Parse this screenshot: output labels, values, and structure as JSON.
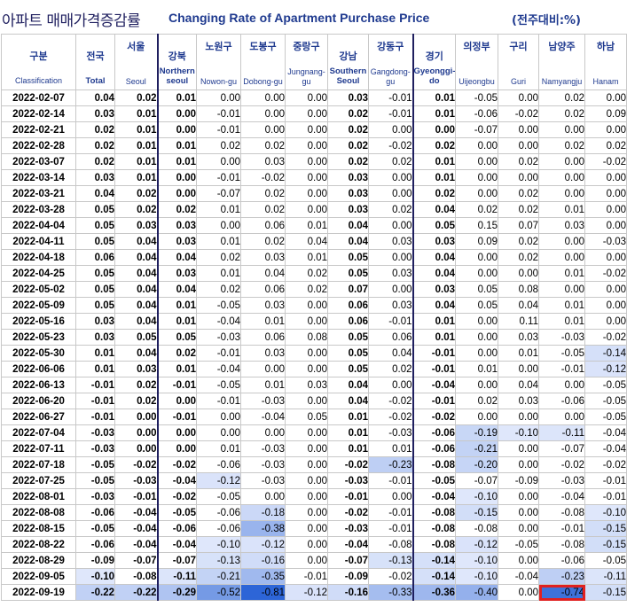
{
  "title_ko": "아파트 매매가격증감률",
  "title_en": "Changing Rate of Apartment Purchase Price",
  "unit": "(전주대비:%)",
  "columns": [
    {
      "ko": "구분",
      "en": "Classification"
    },
    {
      "ko": "전국",
      "en": "Total"
    },
    {
      "ko": "서울",
      "en": "Seoul"
    },
    {
      "ko": "강북",
      "en": "Northern seoul"
    },
    {
      "ko": "노원구",
      "en": "Nowon-gu"
    },
    {
      "ko": "도봉구",
      "en": "Dobong-gu"
    },
    {
      "ko": "중랑구",
      "en": "Jungnang-gu"
    },
    {
      "ko": "강남",
      "en": "Southern Seoul"
    },
    {
      "ko": "강동구",
      "en": "Gangdong-gu"
    },
    {
      "ko": "경기",
      "en": "Gyeonggi-do"
    },
    {
      "ko": "의정부",
      "en": "Uijeongbu"
    },
    {
      "ko": "구리",
      "en": "Guri"
    },
    {
      "ko": "남양주",
      "en": "Namyangju"
    },
    {
      "ko": "하남",
      "en": "Hanam"
    }
  ],
  "rows": [
    [
      "2022-02-07",
      "0.04",
      "0.02",
      "0.01",
      "0.00",
      "0.00",
      "0.00",
      "0.03",
      "-0.01",
      "0.01",
      "-0.05",
      "0.00",
      "0.02",
      "0.00"
    ],
    [
      "2022-02-14",
      "0.03",
      "0.01",
      "0.00",
      "-0.01",
      "0.00",
      "0.00",
      "0.02",
      "-0.01",
      "0.01",
      "-0.06",
      "-0.02",
      "0.02",
      "0.09"
    ],
    [
      "2022-02-21",
      "0.02",
      "0.01",
      "0.00",
      "-0.01",
      "0.00",
      "0.00",
      "0.02",
      "0.00",
      "0.00",
      "-0.07",
      "0.00",
      "0.00",
      "0.00"
    ],
    [
      "2022-02-28",
      "0.02",
      "0.01",
      "0.01",
      "0.02",
      "0.02",
      "0.00",
      "0.02",
      "-0.02",
      "0.02",
      "0.00",
      "0.00",
      "0.02",
      "0.02"
    ],
    [
      "2022-03-07",
      "0.02",
      "0.01",
      "0.01",
      "0.00",
      "0.03",
      "0.00",
      "0.02",
      "0.02",
      "0.01",
      "0.00",
      "0.02",
      "0.00",
      "-0.02"
    ],
    [
      "2022-03-14",
      "0.03",
      "0.01",
      "0.00",
      "-0.01",
      "-0.02",
      "0.00",
      "0.03",
      "0.00",
      "0.01",
      "0.00",
      "0.00",
      "0.00",
      "0.00"
    ],
    [
      "2022-03-21",
      "0.04",
      "0.02",
      "0.00",
      "-0.07",
      "0.02",
      "0.00",
      "0.03",
      "0.00",
      "0.02",
      "0.00",
      "0.02",
      "0.00",
      "0.00"
    ],
    [
      "2022-03-28",
      "0.05",
      "0.02",
      "0.02",
      "0.01",
      "0.02",
      "0.00",
      "0.03",
      "0.02",
      "0.04",
      "0.02",
      "0.02",
      "0.01",
      "0.00"
    ],
    [
      "2022-04-04",
      "0.05",
      "0.03",
      "0.03",
      "0.00",
      "0.06",
      "0.01",
      "0.04",
      "0.00",
      "0.05",
      "0.15",
      "0.07",
      "0.03",
      "0.00"
    ],
    [
      "2022-04-11",
      "0.05",
      "0.04",
      "0.03",
      "0.01",
      "0.02",
      "0.04",
      "0.04",
      "0.03",
      "0.03",
      "0.09",
      "0.02",
      "0.00",
      "-0.03"
    ],
    [
      "2022-04-18",
      "0.06",
      "0.04",
      "0.04",
      "0.02",
      "0.03",
      "0.01",
      "0.05",
      "0.00",
      "0.04",
      "0.00",
      "0.02",
      "0.00",
      "0.00"
    ],
    [
      "2022-04-25",
      "0.05",
      "0.04",
      "0.03",
      "0.01",
      "0.04",
      "0.02",
      "0.05",
      "0.03",
      "0.04",
      "0.00",
      "0.00",
      "0.01",
      "-0.02"
    ],
    [
      "2022-05-02",
      "0.05",
      "0.04",
      "0.04",
      "0.02",
      "0.06",
      "0.02",
      "0.07",
      "0.00",
      "0.03",
      "0.05",
      "0.08",
      "0.00",
      "0.00"
    ],
    [
      "2022-05-09",
      "0.05",
      "0.04",
      "0.01",
      "-0.05",
      "0.03",
      "0.00",
      "0.06",
      "0.03",
      "0.04",
      "0.05",
      "0.04",
      "0.01",
      "0.00"
    ],
    [
      "2022-05-16",
      "0.03",
      "0.04",
      "0.01",
      "-0.04",
      "0.01",
      "0.00",
      "0.06",
      "-0.01",
      "0.01",
      "0.00",
      "0.11",
      "0.01",
      "0.00"
    ],
    [
      "2022-05-23",
      "0.03",
      "0.05",
      "0.05",
      "-0.03",
      "0.06",
      "0.08",
      "0.05",
      "0.06",
      "0.01",
      "0.00",
      "0.03",
      "-0.03",
      "-0.02"
    ],
    [
      "2022-05-30",
      "0.01",
      "0.04",
      "0.02",
      "-0.01",
      "0.03",
      "0.00",
      "0.05",
      "0.04",
      "-0.01",
      "0.00",
      "0.01",
      "-0.05",
      "-0.14"
    ],
    [
      "2022-06-06",
      "0.01",
      "0.03",
      "0.01",
      "-0.04",
      "0.00",
      "0.00",
      "0.05",
      "0.02",
      "-0.01",
      "0.01",
      "0.00",
      "-0.01",
      "-0.12"
    ],
    [
      "2022-06-13",
      "-0.01",
      "0.02",
      "-0.01",
      "-0.05",
      "0.01",
      "0.03",
      "0.04",
      "0.00",
      "-0.04",
      "0.00",
      "0.04",
      "0.00",
      "-0.05"
    ],
    [
      "2022-06-20",
      "-0.01",
      "0.02",
      "0.00",
      "-0.01",
      "-0.03",
      "0.00",
      "0.04",
      "-0.02",
      "-0.01",
      "0.02",
      "0.03",
      "-0.06",
      "-0.05"
    ],
    [
      "2022-06-27",
      "-0.01",
      "0.00",
      "-0.01",
      "0.00",
      "-0.04",
      "0.05",
      "0.01",
      "-0.02",
      "-0.02",
      "0.00",
      "0.00",
      "0.00",
      "-0.05"
    ],
    [
      "2022-07-04",
      "-0.03",
      "0.00",
      "0.00",
      "0.00",
      "0.00",
      "0.00",
      "0.01",
      "-0.03",
      "-0.06",
      "-0.19",
      "-0.10",
      "-0.11",
      "-0.04"
    ],
    [
      "2022-07-11",
      "-0.03",
      "0.00",
      "0.00",
      "0.01",
      "-0.03",
      "0.00",
      "0.01",
      "0.01",
      "-0.06",
      "-0.21",
      "0.00",
      "-0.07",
      "-0.04"
    ],
    [
      "2022-07-18",
      "-0.05",
      "-0.02",
      "-0.02",
      "-0.06",
      "-0.03",
      "0.00",
      "-0.02",
      "-0.23",
      "-0.08",
      "-0.20",
      "0.00",
      "-0.02",
      "-0.02"
    ],
    [
      "2022-07-25",
      "-0.05",
      "-0.03",
      "-0.04",
      "-0.12",
      "-0.03",
      "0.00",
      "-0.03",
      "-0.01",
      "-0.05",
      "-0.07",
      "-0.09",
      "-0.03",
      "-0.01"
    ],
    [
      "2022-08-01",
      "-0.03",
      "-0.01",
      "-0.02",
      "-0.05",
      "0.00",
      "0.00",
      "-0.01",
      "0.00",
      "-0.04",
      "-0.10",
      "0.00",
      "-0.04",
      "-0.01"
    ],
    [
      "2022-08-08",
      "-0.06",
      "-0.04",
      "-0.05",
      "-0.06",
      "-0.18",
      "0.00",
      "-0.02",
      "-0.01",
      "-0.08",
      "-0.15",
      "0.00",
      "-0.08",
      "-0.10"
    ],
    [
      "2022-08-15",
      "-0.05",
      "-0.04",
      "-0.06",
      "-0.06",
      "-0.38",
      "0.00",
      "-0.03",
      "-0.01",
      "-0.08",
      "-0.08",
      "0.00",
      "-0.01",
      "-0.15"
    ],
    [
      "2022-08-22",
      "-0.06",
      "-0.04",
      "-0.04",
      "-0.10",
      "-0.12",
      "0.00",
      "-0.04",
      "-0.08",
      "-0.08",
      "-0.12",
      "-0.05",
      "-0.08",
      "-0.15"
    ],
    [
      "2022-08-29",
      "-0.09",
      "-0.07",
      "-0.07",
      "-0.13",
      "-0.16",
      "0.00",
      "-0.07",
      "-0.13",
      "-0.14",
      "-0.10",
      "0.00",
      "-0.06",
      "-0.05"
    ],
    [
      "2022-09-05",
      "-0.10",
      "-0.08",
      "-0.11",
      "-0.21",
      "-0.35",
      "-0.01",
      "-0.09",
      "-0.02",
      "-0.14",
      "-0.10",
      "-0.04",
      "-0.23",
      "-0.11"
    ],
    [
      "2022-09-19",
      "-0.22",
      "-0.22",
      "-0.29",
      "-0.52",
      "-0.81",
      "-0.12",
      "-0.16",
      "-0.33",
      "-0.36",
      "-0.40",
      "0.00",
      "-0.74",
      "-0.15"
    ]
  ],
  "highlight_cell": {
    "row": 31,
    "col": 12
  },
  "colors": {
    "scale_light": "#dfe7fb",
    "scale_dark": "#2a63d6",
    "highlight_border": "#e02020",
    "header_text": "#1f3a8f"
  }
}
